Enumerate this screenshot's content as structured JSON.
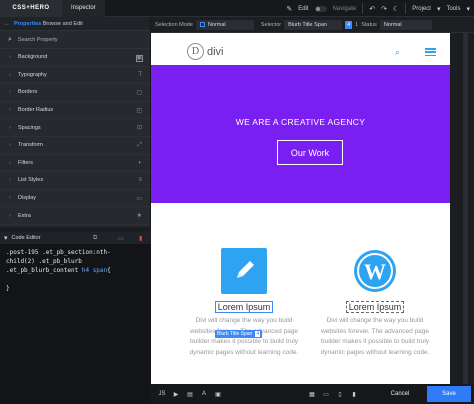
{
  "app": {
    "logo": "CSS+HERO",
    "tab": "Inspector"
  },
  "topbar": {
    "edit_label": "Edit",
    "navigate_label": "Navigate",
    "project_label": "Project",
    "tools_label": "Tools"
  },
  "settings": {
    "selection_mode_label": "Selection Mode",
    "selection_mode_value": "Normal",
    "selector_label": "Selector",
    "selector_value": "Blurb Title Span",
    "selector_badge": "4",
    "selector_count": "1",
    "status_label": "Status",
    "status_value": "Normal"
  },
  "inspector": {
    "header_title": "Properties",
    "header_sub": "Browse and Edit",
    "search_placeholder": "Search Property",
    "groups": [
      {
        "label": "Background",
        "icon": "image-icon"
      },
      {
        "label": "Typography",
        "icon": "text-icon"
      },
      {
        "label": "Borders",
        "icon": "border-icon"
      },
      {
        "label": "Border Radius",
        "icon": "radius-icon"
      },
      {
        "label": "Spacings",
        "icon": "spacing-icon"
      },
      {
        "label": "Transform",
        "icon": "transform-icon"
      },
      {
        "label": "Filters",
        "icon": "filter-icon"
      },
      {
        "label": "List Styles",
        "icon": "list-icon"
      },
      {
        "label": "Display",
        "icon": "display-icon"
      },
      {
        "label": "Extra",
        "icon": "star-icon"
      }
    ]
  },
  "code_editor": {
    "title": "Code Editor",
    "line1": ".post-195 .et_pb_section:nth-",
    "line2": "child(2) .et_pb_blurb",
    "line3_a": ".et_pb_blurb_content ",
    "line3_b": "h4 span",
    "line3_c": "{",
    "line4": "}"
  },
  "site": {
    "logo_letter": "D",
    "logo_text": "divi",
    "hero_title": "WE ARE A CREATIVE AGENCY",
    "hero_button": "Our Work",
    "blurb1_title": "Lorem Ipsum",
    "blurb1_text": "Divi will change the way you build websites forever. The advanced page builder makes it possible to build truly dynamic pages without learning code.",
    "blurb2_title": "Lorem Ipsum",
    "blurb2_text": "Divi will change the way you build websites forever. The advanced page builder makes it possible to build truly dynamic pages without learning code.",
    "selected_tag": "Blurb Title Span",
    "selected_tag_num": "4"
  },
  "bottombar": {
    "js_label": "JS",
    "cancel_label": "Cancel",
    "save_label": "Save"
  },
  "colors": {
    "accent": "#3d8af7",
    "hero_bg": "#7a1ff2",
    "divi_blue": "#2ea3f2"
  }
}
